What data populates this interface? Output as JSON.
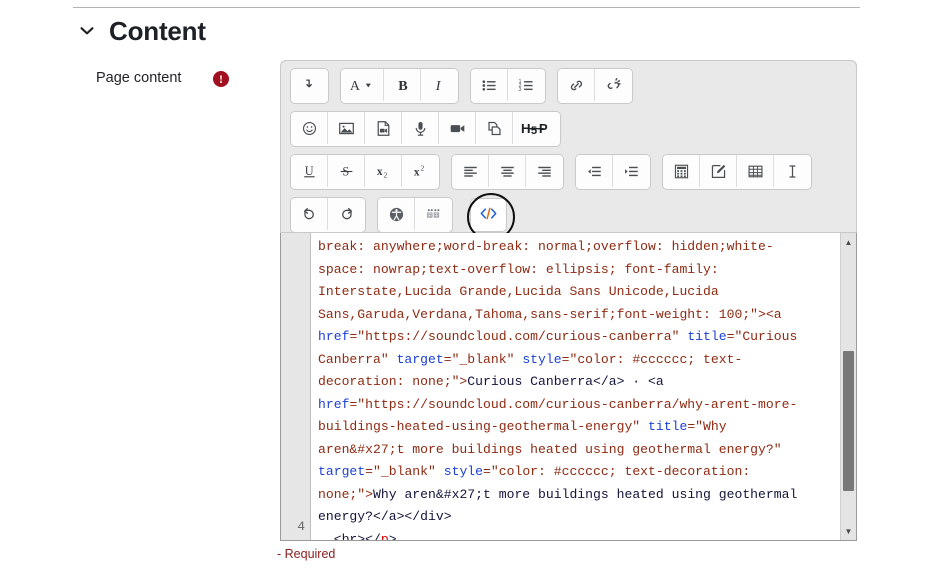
{
  "section": {
    "title": "Content",
    "collapse_icon": "chevron-down-icon",
    "expanded": true
  },
  "field": {
    "label": "Page content",
    "required_marker": "!",
    "required_note": "- Required"
  },
  "toolbar": {
    "rows": [
      {
        "groups": [
          {
            "buttons": [
              {
                "name": "toolbar-toggle-button",
                "icon": "arrow-down-turn-icon",
                "label": "Show more buttons"
              }
            ]
          },
          {
            "buttons": [
              {
                "name": "font-style-button",
                "icon": "font-style-a-dropdown-icon",
                "label": "A"
              },
              {
                "name": "bold-button",
                "icon": "bold-icon",
                "label": "B"
              },
              {
                "name": "italic-button",
                "icon": "italic-icon",
                "label": "I"
              }
            ]
          },
          {
            "buttons": [
              {
                "name": "bulleted-list-button",
                "icon": "bulleted-list-icon",
                "label": "Bulleted list"
              },
              {
                "name": "numbered-list-button",
                "icon": "numbered-list-icon",
                "label": "Numbered list"
              }
            ]
          },
          {
            "buttons": [
              {
                "name": "link-button",
                "icon": "link-icon",
                "label": "Link"
              },
              {
                "name": "unlink-button",
                "icon": "unlink-icon",
                "label": "Unlink"
              }
            ]
          }
        ]
      },
      {
        "groups": [
          {
            "buttons": [
              {
                "name": "emoji-button",
                "icon": "smiley-face-icon",
                "label": "Emoji picker"
              },
              {
                "name": "image-button",
                "icon": "image-icon",
                "label": "Image"
              },
              {
                "name": "media-file-button",
                "icon": "media-file-icon",
                "label": "Media"
              },
              {
                "name": "audio-record-button",
                "icon": "microphone-icon",
                "label": "Record audio"
              },
              {
                "name": "video-record-button",
                "icon": "video-camera-icon",
                "label": "Record video"
              },
              {
                "name": "manage-files-button",
                "icon": "copy-files-icon",
                "label": "Manage files"
              },
              {
                "name": "h5p-button",
                "icon": "h5p-logo-icon",
                "label": "H5P"
              }
            ]
          }
        ]
      },
      {
        "groups": [
          {
            "buttons": [
              {
                "name": "underline-button",
                "icon": "underline-icon",
                "label": "U"
              },
              {
                "name": "strikethrough-button",
                "icon": "strikethrough-icon",
                "label": "S"
              },
              {
                "name": "subscript-button",
                "icon": "subscript-icon",
                "label": "x2"
              },
              {
                "name": "superscript-button",
                "icon": "superscript-icon",
                "label": "x2"
              }
            ]
          },
          {
            "buttons": [
              {
                "name": "align-left-button",
                "icon": "align-left-icon",
                "label": "Align left"
              },
              {
                "name": "align-center-button",
                "icon": "align-center-icon",
                "label": "Align center"
              },
              {
                "name": "align-right-button",
                "icon": "align-right-icon",
                "label": "Align right"
              }
            ]
          },
          {
            "buttons": [
              {
                "name": "outdent-button",
                "icon": "outdent-icon",
                "label": "Decrease indent"
              },
              {
                "name": "indent-button",
                "icon": "indent-icon",
                "label": "Increase indent"
              }
            ]
          },
          {
            "buttons": [
              {
                "name": "equation-button",
                "icon": "calculator-equation-icon",
                "label": "Equation editor"
              },
              {
                "name": "chemistry-button",
                "icon": "pencil-box-icon",
                "label": "Chemistry editor"
              },
              {
                "name": "table-button",
                "icon": "table-grid-icon",
                "label": "Table"
              },
              {
                "name": "special-character-button",
                "icon": "text-cursor-icon",
                "label": "Insert character"
              }
            ]
          }
        ]
      },
      {
        "groups": [
          {
            "buttons": [
              {
                "name": "undo-button",
                "icon": "undo-arrow-icon",
                "label": "Undo"
              },
              {
                "name": "redo-button",
                "icon": "redo-arrow-icon",
                "label": "Redo"
              }
            ]
          },
          {
            "buttons": [
              {
                "name": "accessibility-checker-button",
                "icon": "accessibility-person-icon",
                "label": "Accessibility checker"
              },
              {
                "name": "screenreader-helper-button",
                "icon": "braille-dots-icon",
                "label": "Screenreader helper"
              }
            ]
          }
        ],
        "highlighted": {
          "name": "html-source-button",
          "icon": "code-angle-brackets-icon",
          "label": "</>",
          "annotation": "circled"
        }
      }
    ]
  },
  "code_editor": {
    "visible_line_number": "4",
    "lines": [
      [
        {
          "t": "plain",
          "s": "break: anywhere;word-break: normal;overflow: hidden;white-"
        }
      ],
      [
        {
          "t": "plain",
          "s": "space: nowrap;text-overflow: ellipsis; font-family: "
        }
      ],
      [
        {
          "t": "plain",
          "s": "Interstate,Lucida Grande,Lucida Sans Unicode,Lucida "
        }
      ],
      [
        {
          "t": "plain",
          "s": "Sans,Garuda,Verdana,Tahoma,sans-serif;font-weight: 100;\"><a"
        }
      ],
      [
        {
          "t": "attr",
          "s": "href"
        },
        {
          "t": "val",
          "s": "=\"https://soundcloud.com/curious-canberra\" "
        },
        {
          "t": "attr",
          "s": "title"
        },
        {
          "t": "val",
          "s": "=\"Curious"
        }
      ],
      [
        {
          "t": "val",
          "s": "Canberra\" "
        },
        {
          "t": "attr",
          "s": "target"
        },
        {
          "t": "val",
          "s": "=\"_blank\" "
        },
        {
          "t": "attr",
          "s": "style"
        },
        {
          "t": "val",
          "s": "=\"color: #cccccc; text-"
        }
      ],
      [
        {
          "t": "val",
          "s": "decoration: none;\">"
        },
        {
          "t": "txt",
          "s": "Curious Canberra</a> · <a"
        }
      ],
      [
        {
          "t": "attr",
          "s": "href"
        },
        {
          "t": "val",
          "s": "=\"https://soundcloud.com/curious-canberra/why-arent-more-"
        }
      ],
      [
        {
          "t": "val",
          "s": "buildings-heated-using-geothermal-energy\" "
        },
        {
          "t": "attr",
          "s": "title"
        },
        {
          "t": "val",
          "s": "=\"Why"
        }
      ],
      [
        {
          "t": "val",
          "s": "aren&#x27;t more buildings heated using geothermal energy?\""
        }
      ],
      [
        {
          "t": "attr",
          "s": "target"
        },
        {
          "t": "val",
          "s": "=\"_blank\" "
        },
        {
          "t": "attr",
          "s": "style"
        },
        {
          "t": "val",
          "s": "=\"color: #cccccc; text-decoration:"
        }
      ],
      [
        {
          "t": "val",
          "s": "none;\">"
        },
        {
          "t": "txt",
          "s": "Why aren&#x27;t more buildings heated using geothermal"
        }
      ],
      [
        {
          "t": "txt",
          "s": "energy?</a></div>"
        }
      ],
      [
        {
          "t": "txt",
          "s": "  <br></"
        },
        {
          "t": "err",
          "s": "p"
        },
        {
          "t": "txt",
          "s": ">"
        }
      ]
    ],
    "scrollbar": {
      "up_arrow": "▲",
      "down_arrow": "▼"
    }
  },
  "colors": {
    "accent_required": "#a01020",
    "attribute": "#1b3fd8",
    "value": "#8f2a12",
    "error": "#e00000",
    "toolbar_bg": "#e9e9e9"
  }
}
